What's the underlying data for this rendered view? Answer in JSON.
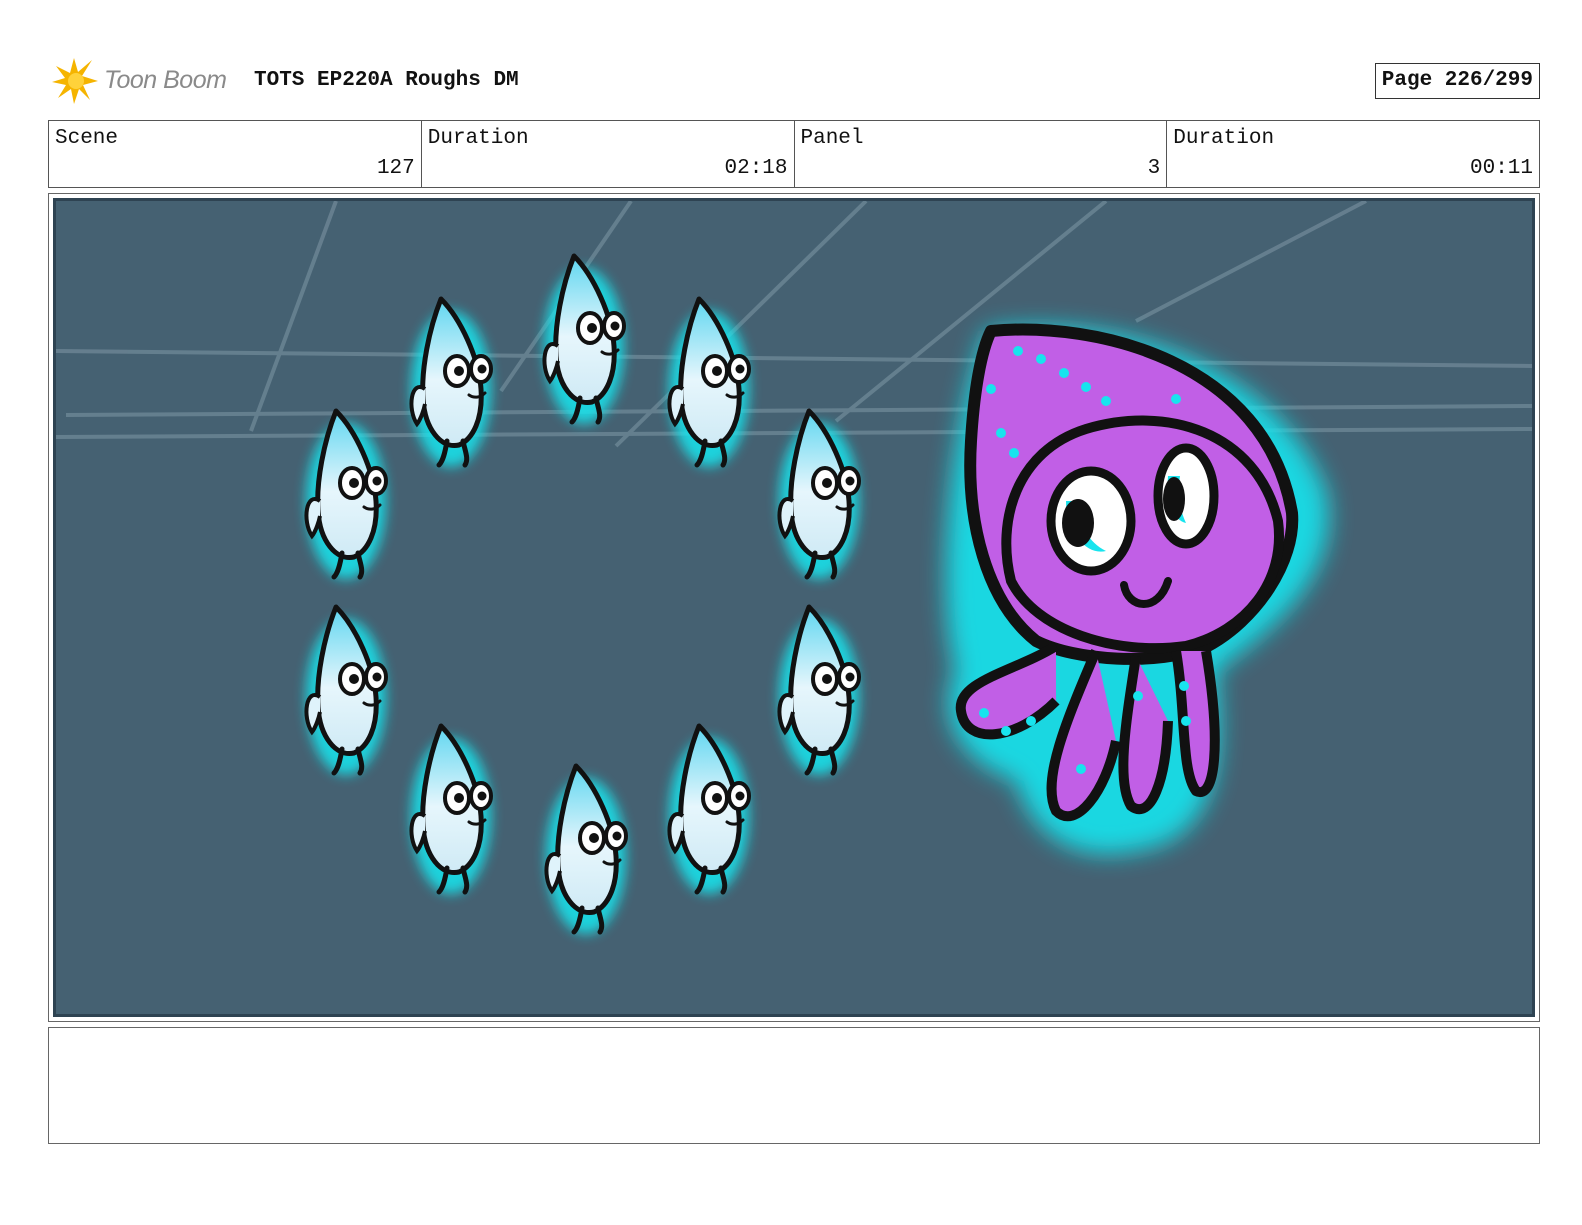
{
  "header": {
    "logo_text": "Toon Boom",
    "title": "TOTS EP220A Roughs DM",
    "page": "Page 226/299"
  },
  "info": {
    "scene_label": "Scene",
    "scene_value": "127",
    "scene_duration_label": "Duration",
    "scene_duration_value": "02:18",
    "panel_label": "Panel",
    "panel_value": "3",
    "panel_duration_label": "Duration",
    "panel_duration_value": "00:11"
  },
  "colors": {
    "background": "#456172",
    "glow": "#1ff0f0",
    "squid_body": "#c15fe6",
    "fish_body": "#dff3fb"
  },
  "notes": ""
}
